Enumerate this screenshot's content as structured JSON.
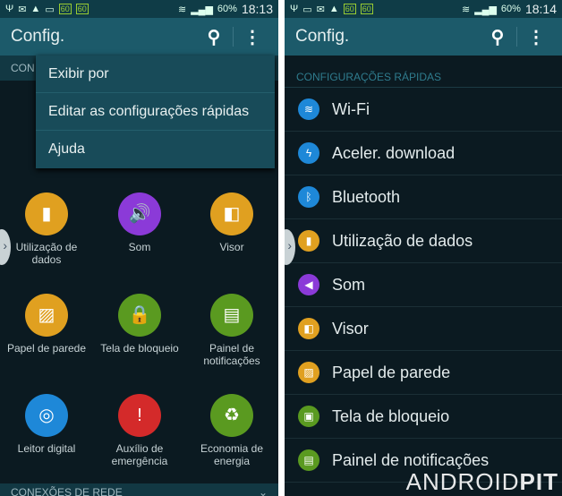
{
  "left": {
    "status": {
      "time": "18:13",
      "battery": "60%",
      "badges": [
        "60",
        "60"
      ]
    },
    "appbar": {
      "title": "Config."
    },
    "section_partial": "CON",
    "menu": [
      "Exibir por",
      "Editar as configurações rápidas",
      "Ajuda"
    ],
    "grid": [
      {
        "label": "Utilização de dados",
        "color": "#e0a020",
        "icon": "bar-chart-icon",
        "glyph": "▮"
      },
      {
        "label": "Som",
        "color": "#8b3ad8",
        "icon": "speaker-icon",
        "glyph": "🔊"
      },
      {
        "label": "Visor",
        "color": "#e0a020",
        "icon": "display-icon",
        "glyph": "◧"
      },
      {
        "label": "Papel de parede",
        "color": "#e0a020",
        "icon": "wallpaper-icon",
        "glyph": "▨"
      },
      {
        "label": "Tela de bloqueio",
        "color": "#5a9a20",
        "icon": "lock-screen-icon",
        "glyph": "🔒"
      },
      {
        "label": "Painel de notificações",
        "color": "#5a9a20",
        "icon": "notification-panel-icon",
        "glyph": "▤"
      },
      {
        "label": "Leitor digital",
        "color": "#1e88d8",
        "icon": "fingerprint-icon",
        "glyph": "◎"
      },
      {
        "label": "Auxílio de emergência",
        "color": "#d42a2a",
        "icon": "emergency-icon",
        "glyph": "!"
      },
      {
        "label": "Economia de energia",
        "color": "#5a9a20",
        "icon": "battery-recycle-icon",
        "glyph": "♻"
      }
    ],
    "bottom_section": "CONEXÕES DE REDE"
  },
  "right": {
    "status": {
      "time": "18:14",
      "battery": "60%",
      "badges": [
        "60",
        "60"
      ]
    },
    "appbar": {
      "title": "Config."
    },
    "section": "CONFIGURAÇÕES RÁPIDAS",
    "rows": [
      {
        "label": "Wi-Fi",
        "color": "#1e88d8",
        "icon": "wifi-icon",
        "glyph": "≋"
      },
      {
        "label": "Aceler. download",
        "color": "#1e88d8",
        "icon": "download-booster-icon",
        "glyph": "ϟ"
      },
      {
        "label": "Bluetooth",
        "color": "#1e88d8",
        "icon": "bluetooth-icon",
        "glyph": "ᛒ"
      },
      {
        "label": "Utilização de dados",
        "color": "#e0a020",
        "icon": "bar-chart-icon",
        "glyph": "▮"
      },
      {
        "label": "Som",
        "color": "#8b3ad8",
        "icon": "speaker-icon",
        "glyph": "◀"
      },
      {
        "label": "Visor",
        "color": "#e0a020",
        "icon": "display-icon",
        "glyph": "◧"
      },
      {
        "label": "Papel de parede",
        "color": "#e0a020",
        "icon": "wallpaper-icon",
        "glyph": "▨"
      },
      {
        "label": "Tela de bloqueio",
        "color": "#5a9a20",
        "icon": "lock-screen-icon",
        "glyph": "▣"
      },
      {
        "label": "Painel de notificações",
        "color": "#5a9a20",
        "icon": "notification-panel-icon",
        "glyph": "▤"
      }
    ]
  },
  "watermark": {
    "a": "ANDROID",
    "b": "PIT"
  }
}
